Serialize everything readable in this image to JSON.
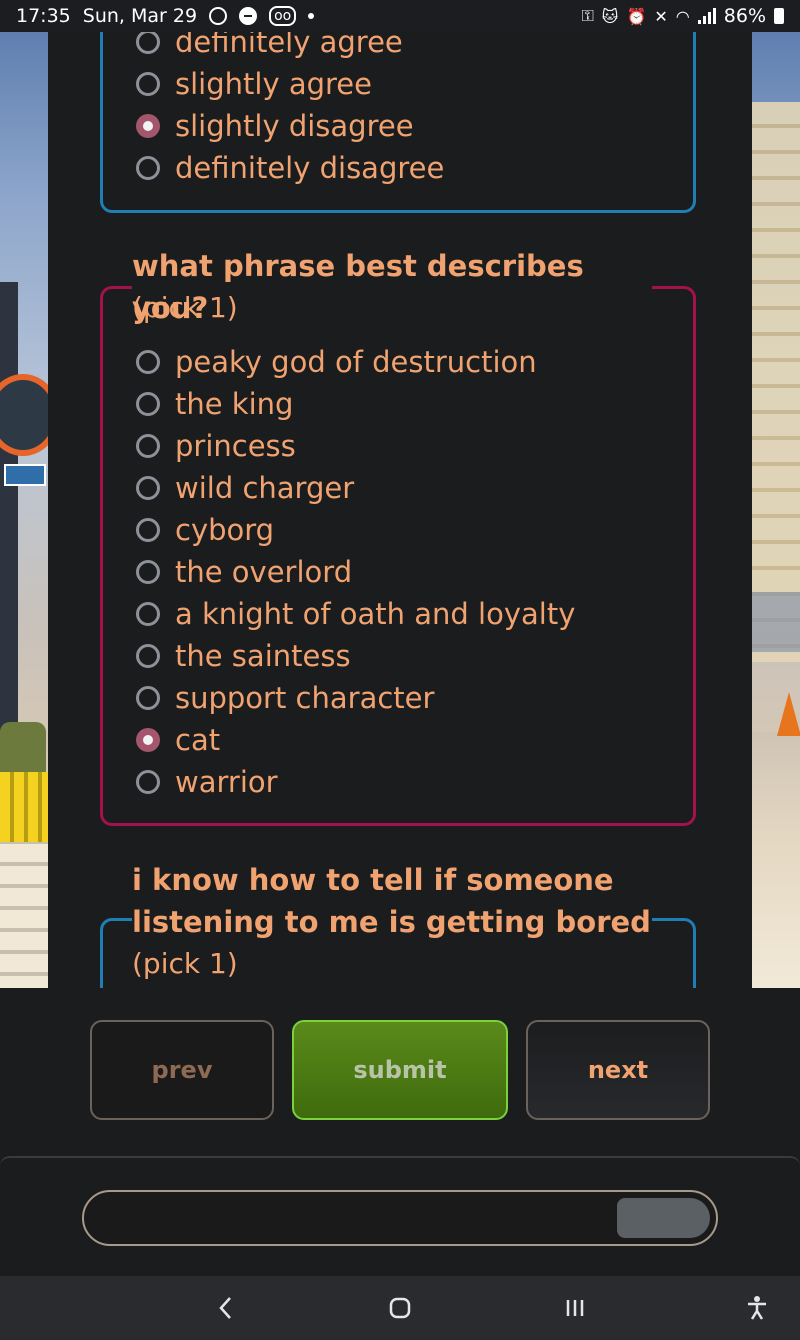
{
  "status_bar": {
    "time": "17:35",
    "date": "Sun, Mar 29",
    "battery": "86%",
    "icons": [
      "data-saver-icon",
      "dnd-icon",
      "voicemail-icon",
      "dot-icon",
      "key-icon",
      "cat-icon",
      "alarm-icon",
      "mute-icon",
      "wifi-icon",
      "signal-icon",
      "battery-icon"
    ]
  },
  "questions": [
    {
      "title": "",
      "hint": "",
      "color": "#1f7fb5",
      "options": [
        {
          "label": "definitely agree",
          "selected": false
        },
        {
          "label": "slightly agree",
          "selected": false
        },
        {
          "label": "slightly disagree",
          "selected": true
        },
        {
          "label": "definitely disagree",
          "selected": false
        }
      ]
    },
    {
      "title": "what phrase best describes you?",
      "hint": "(pick 1)",
      "color": "#a3124a",
      "options": [
        {
          "label": "peaky god of destruction",
          "selected": false
        },
        {
          "label": "the king",
          "selected": false
        },
        {
          "label": "princess",
          "selected": false
        },
        {
          "label": "wild charger",
          "selected": false
        },
        {
          "label": "cyborg",
          "selected": false
        },
        {
          "label": "the overlord",
          "selected": false
        },
        {
          "label": "a knight of oath and loyalty",
          "selected": false
        },
        {
          "label": "the saintess",
          "selected": false
        },
        {
          "label": "support character",
          "selected": false
        },
        {
          "label": "cat",
          "selected": true
        },
        {
          "label": "warrior",
          "selected": false
        }
      ]
    },
    {
      "title_line1": "i know how to tell if someone",
      "title_line2": "listening to me is getting bored",
      "hint": "(pick 1)",
      "color": "#1f7fb5"
    }
  ],
  "controls": {
    "prev_label": "prev",
    "submit_label": "submit",
    "next_label": "next"
  },
  "progress": {
    "fraction": 0.15
  },
  "colors": {
    "accent_text": "#f0a370",
    "selected_radio": "#a4566c",
    "submit_border": "#7bd13a"
  },
  "nav_bar": {
    "icons": [
      "back-icon",
      "home-icon",
      "recents-icon",
      "accessibility-icon"
    ]
  }
}
